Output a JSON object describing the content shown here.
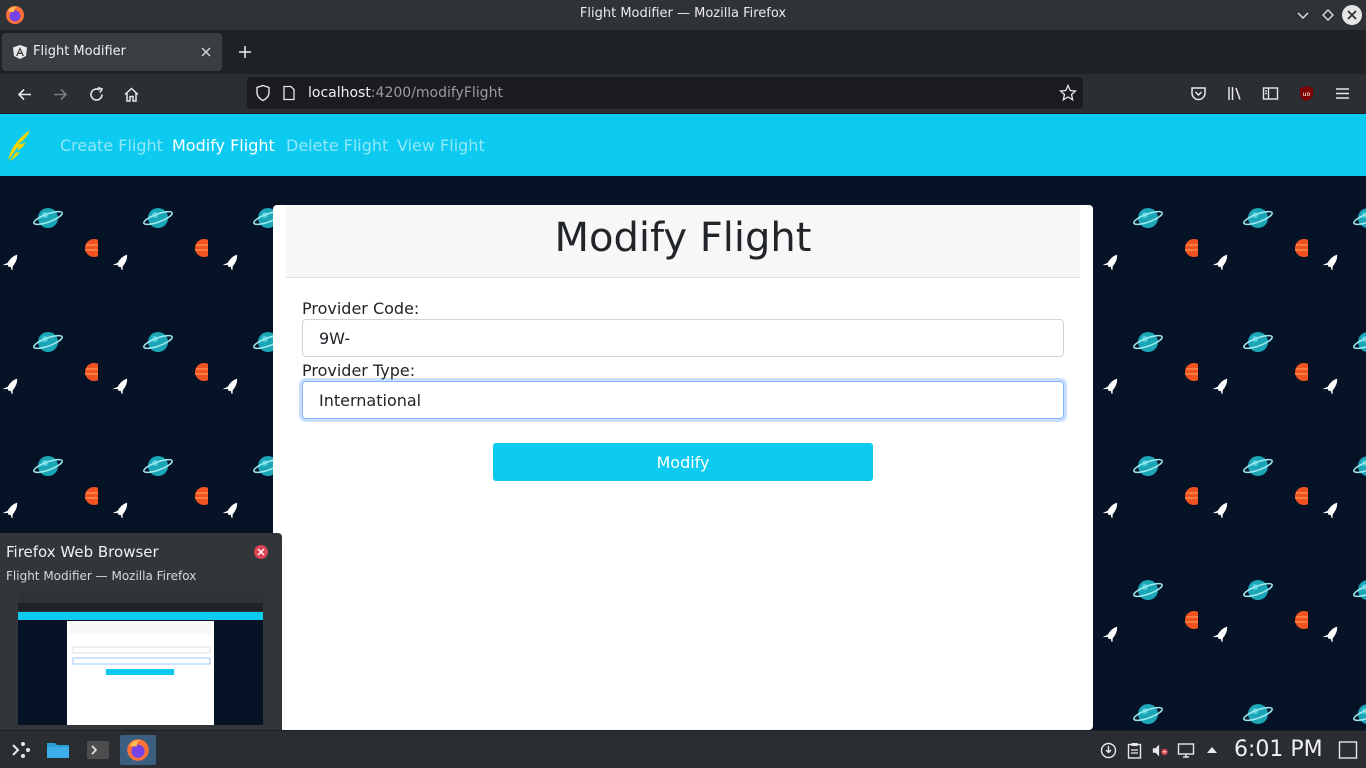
{
  "window": {
    "title": "Flight Modifier — Mozilla Firefox"
  },
  "tabs": [
    {
      "label": "Flight Modifier",
      "active": true
    }
  ],
  "urlbar": {
    "host": "localhost",
    "path": ":4200/modifyFlight"
  },
  "app_nav": {
    "links": [
      {
        "label": "Create Flight",
        "active": false
      },
      {
        "label": "Modify Flight",
        "active": true
      },
      {
        "label": "Delete Flight",
        "active": false
      },
      {
        "label": "View Flight",
        "active": false
      }
    ]
  },
  "form": {
    "title": "Modify Flight",
    "provider_code_label": "Provider Code:",
    "provider_code_value": "9W-",
    "provider_type_label": "Provider Type:",
    "provider_type_value": "International",
    "submit_label": "Modify"
  },
  "preview": {
    "title": "Firefox Web Browser",
    "subtitle": "Flight Modifier — Mozilla Firefox"
  },
  "taskbar": {
    "clock": "6:01 PM"
  },
  "colors": {
    "accent": "#0dcaf0",
    "page_bg": "#061226",
    "planet_orange": "#f0531f",
    "planet_teal": "#1aa6b7"
  }
}
